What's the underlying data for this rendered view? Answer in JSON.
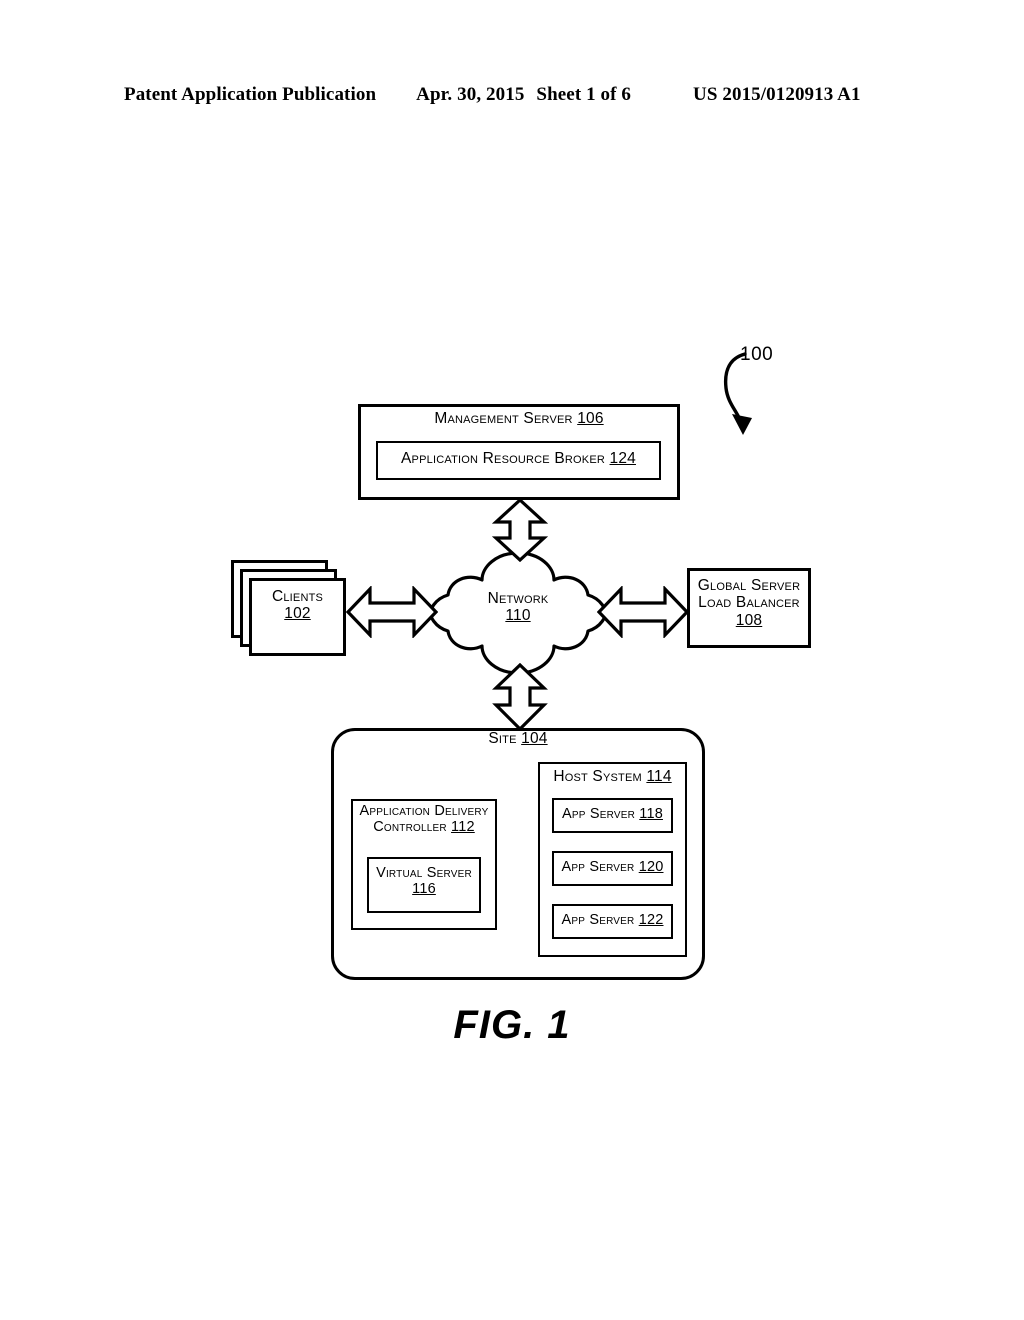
{
  "header": {
    "publication": "Patent Application Publication",
    "date": "Apr. 30, 2015",
    "sheet": "Sheet 1 of 6",
    "patent_number": "US 2015/0120913 A1"
  },
  "figure": {
    "caption": "FIG. 1",
    "system_ref": "100"
  },
  "diagram": {
    "management_server": {
      "title": "Management Server ",
      "ref": "106",
      "child": {
        "title": "Application Resource Broker ",
        "ref": "124"
      }
    },
    "clients": {
      "title": "Clients",
      "ref": "102"
    },
    "network": {
      "title": "Network",
      "ref": "110"
    },
    "global_server_load_balancer": {
      "line1": "Global Server",
      "line2": "Load Balancer",
      "ref": "108"
    },
    "site": {
      "title": "Site ",
      "ref": "104",
      "application_delivery_controller": {
        "line1": "Application Delivery",
        "line2": "Controller ",
        "ref": "112",
        "virtual_server": {
          "title": "Virtual Server",
          "ref": "116"
        }
      },
      "host_system": {
        "title": "Host System ",
        "ref": "114",
        "app_servers": [
          {
            "title": "App Server ",
            "ref": "118"
          },
          {
            "title": "App Server ",
            "ref": "120"
          },
          {
            "title": "App Server ",
            "ref": "122"
          }
        ]
      }
    },
    "connections": [
      {
        "name": "management-server-to-network",
        "orientation": "vertical"
      },
      {
        "name": "clients-to-network",
        "orientation": "horizontal"
      },
      {
        "name": "network-to-gslb",
        "orientation": "horizontal"
      },
      {
        "name": "network-to-site",
        "orientation": "vertical"
      }
    ]
  },
  "colors": {
    "ink": "#000000",
    "paper": "#ffffff"
  }
}
